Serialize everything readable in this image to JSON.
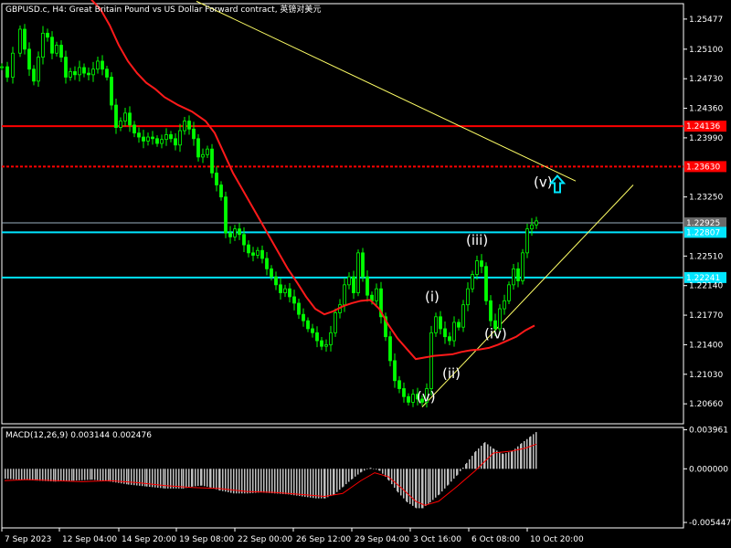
{
  "window_title": "GBPUSD.c, H4:  Great Britain Pound vs US Dollar Forward contract, 英镑对美元",
  "colors": {
    "background": "#000000",
    "candle": "#00ff00",
    "ma": "#ff1a1a",
    "resistance": "#ff0000",
    "support": "#00e5ff",
    "trendline": "#ffff66",
    "macd_hist": "#c0c0c0",
    "macd_signal": "#ff0000",
    "arrow": "#00e5ff",
    "axis_text": "#ffffff"
  },
  "chart_data": [
    {
      "type": "candlestick",
      "title": "GBPUSD.c, H4:  Great Britain Pound vs US Dollar Forward contract, 英镑对美元",
      "ylim": [
        1.2041,
        1.2567
      ],
      "y_ticks": [
        "1.25477",
        "1.25100",
        "1.24730",
        "1.24360",
        "1.23990",
        "1.23250",
        "1.22510",
        "1.22140",
        "1.21770",
        "1.21400",
        "1.21030",
        "1.20660"
      ],
      "x_ticks": [
        "7 Sep 2023",
        "12 Sep 04:00",
        "14 Sep 20:00",
        "19 Sep 08:00",
        "22 Sep 00:00",
        "26 Sep 12:00",
        "29 Sep 04:00",
        "3 Oct 16:00",
        "6 Oct 08:00",
        "10 Oct 20:00"
      ],
      "close_path": [
        [
          0,
          1.2488
        ],
        [
          6,
          1.2475
        ],
        [
          12,
          1.2505
        ],
        [
          20,
          1.2535
        ],
        [
          25,
          1.251
        ],
        [
          30,
          1.2485
        ],
        [
          35,
          1.247
        ],
        [
          40,
          1.25
        ],
        [
          45,
          1.253
        ],
        [
          50,
          1.2525
        ],
        [
          55,
          1.2505
        ],
        [
          60,
          1.2515
        ],
        [
          65,
          1.25
        ],
        [
          70,
          1.2475
        ],
        [
          75,
          1.2482
        ],
        [
          80,
          1.2478
        ],
        [
          85,
          1.2487
        ],
        [
          90,
          1.248
        ],
        [
          95,
          1.2478
        ],
        [
          100,
          1.2485
        ],
        [
          105,
          1.2495
        ],
        [
          110,
          1.2485
        ],
        [
          115,
          1.2475
        ],
        [
          120,
          1.244
        ],
        [
          125,
          1.2412
        ],
        [
          130,
          1.242
        ],
        [
          135,
          1.243
        ],
        [
          140,
          1.2415
        ],
        [
          145,
          1.2405
        ],
        [
          150,
          1.24
        ],
        [
          155,
          1.2395
        ],
        [
          160,
          1.24
        ],
        [
          165,
          1.2398
        ],
        [
          170,
          1.2392
        ],
        [
          175,
          1.2397
        ],
        [
          180,
          1.2403
        ],
        [
          185,
          1.2398
        ],
        [
          190,
          1.239
        ],
        [
          195,
          1.2408
        ],
        [
          200,
          1.242
        ],
        [
          205,
          1.241
        ],
        [
          210,
          1.2398
        ],
        [
          215,
          1.2375
        ],
        [
          220,
          1.2378
        ],
        [
          225,
          1.2385
        ],
        [
          230,
          1.2355
        ],
        [
          235,
          1.234
        ],
        [
          240,
          1.2325
        ],
        [
          245,
          1.228
        ],
        [
          250,
          1.2275
        ],
        [
          255,
          1.2285
        ],
        [
          260,
          1.2278
        ],
        [
          265,
          1.2265
        ],
        [
          270,
          1.2255
        ],
        [
          275,
          1.2252
        ],
        [
          280,
          1.2258
        ],
        [
          285,
          1.2248
        ],
        [
          290,
          1.2235
        ],
        [
          295,
          1.2225
        ],
        [
          300,
          1.2215
        ],
        [
          305,
          1.2205
        ],
        [
          310,
          1.221
        ],
        [
          315,
          1.22
        ],
        [
          320,
          1.2192
        ],
        [
          325,
          1.2178
        ],
        [
          330,
          1.217
        ],
        [
          335,
          1.216
        ],
        [
          340,
          1.2155
        ],
        [
          345,
          1.2145
        ],
        [
          350,
          1.2138
        ],
        [
          355,
          1.214
        ],
        [
          360,
          1.2155
        ],
        [
          365,
          1.218
        ],
        [
          370,
          1.219
        ],
        [
          375,
          1.2215
        ],
        [
          380,
          1.2225
        ],
        [
          385,
          1.2205
        ],
        [
          390,
          1.2255
        ],
        [
          395,
          1.2225
        ],
        [
          400,
          1.2202
        ],
        [
          405,
          1.2195
        ],
        [
          410,
          1.221
        ],
        [
          415,
          1.2175
        ],
        [
          420,
          1.215
        ],
        [
          425,
          1.212
        ],
        [
          430,
          1.2095
        ],
        [
          435,
          1.2085
        ],
        [
          440,
          1.2075
        ],
        [
          445,
          1.2068
        ],
        [
          450,
          1.2078
        ],
        [
          455,
          1.2072
        ],
        [
          460,
          1.2068
        ],
        [
          465,
          1.2085
        ],
        [
          470,
          1.2155
        ],
        [
          475,
          1.2175
        ],
        [
          480,
          1.216
        ],
        [
          485,
          1.215
        ],
        [
          490,
          1.2145
        ],
        [
          495,
          1.2168
        ],
        [
          500,
          1.2162
        ],
        [
          505,
          1.219
        ],
        [
          510,
          1.221
        ],
        [
          515,
          1.2228
        ],
        [
          520,
          1.2245
        ],
        [
          525,
          1.2238
        ],
        [
          530,
          1.2195
        ],
        [
          535,
          1.217
        ],
        [
          540,
          1.216
        ],
        [
          545,
          1.2185
        ],
        [
          550,
          1.2195
        ],
        [
          555,
          1.2215
        ],
        [
          560,
          1.2235
        ],
        [
          565,
          1.222
        ],
        [
          570,
          1.2255
        ],
        [
          575,
          1.2285
        ],
        [
          580,
          1.229
        ],
        [
          585,
          1.2295
        ]
      ],
      "moving_average": [
        [
          100,
          1.2572
        ],
        [
          110,
          1.256
        ],
        [
          120,
          1.254
        ],
        [
          130,
          1.2515
        ],
        [
          140,
          1.2495
        ],
        [
          150,
          1.248
        ],
        [
          160,
          1.2468
        ],
        [
          170,
          1.246
        ],
        [
          180,
          1.245
        ],
        [
          195,
          1.244
        ],
        [
          210,
          1.2432
        ],
        [
          225,
          1.242
        ],
        [
          235,
          1.2405
        ],
        [
          245,
          1.238
        ],
        [
          255,
          1.2355
        ],
        [
          265,
          1.2335
        ],
        [
          275,
          1.2315
        ],
        [
          285,
          1.2295
        ],
        [
          295,
          1.2275
        ],
        [
          305,
          1.2255
        ],
        [
          315,
          1.2235
        ],
        [
          325,
          1.2218
        ],
        [
          335,
          1.22
        ],
        [
          345,
          1.2185
        ],
        [
          355,
          1.2178
        ],
        [
          365,
          1.2182
        ],
        [
          375,
          1.2188
        ],
        [
          385,
          1.2192
        ],
        [
          395,
          1.2195
        ],
        [
          405,
          1.2196
        ],
        [
          415,
          1.2185
        ],
        [
          425,
          1.2165
        ],
        [
          435,
          1.2148
        ],
        [
          445,
          1.2135
        ],
        [
          455,
          1.2122
        ],
        [
          465,
          1.2124
        ],
        [
          475,
          1.2126
        ],
        [
          485,
          1.2127
        ],
        [
          495,
          1.2128
        ],
        [
          505,
          1.2131
        ],
        [
          515,
          1.2133
        ],
        [
          525,
          1.2134
        ],
        [
          535,
          1.2136
        ],
        [
          545,
          1.214
        ],
        [
          555,
          1.2145
        ],
        [
          565,
          1.215
        ],
        [
          575,
          1.2158
        ],
        [
          585,
          1.2164
        ]
      ],
      "horizontal_levels": [
        {
          "price": 1.24136,
          "label": "1.24136",
          "kind": "resistance"
        },
        {
          "price": 1.2363,
          "label": "1.23630",
          "kind": "resistance"
        },
        {
          "price": 1.22925,
          "label": "1.22925",
          "kind": "current"
        },
        {
          "price": 1.22807,
          "label": "1.22807",
          "kind": "support"
        },
        {
          "price": 1.22241,
          "label": "1.22241",
          "kind": "support"
        }
      ],
      "trendlines": [
        {
          "from": [
            215,
            1.257
          ],
          "to": [
            630,
            1.2345
          ]
        },
        {
          "from": [
            462,
            1.2062
          ],
          "to": [
            693,
            1.234
          ]
        }
      ],
      "wave_labels": [
        {
          "text": "(i)",
          "x": 465,
          "price": 1.2194
        },
        {
          "text": "(ii)",
          "x": 484,
          "price": 1.2098
        },
        {
          "text": "(iii)",
          "x": 510,
          "price": 1.2265
        },
        {
          "text": "(iv)",
          "x": 530,
          "price": 1.2148
        },
        {
          "text": "(v)",
          "x": 456,
          "price": 1.2069
        },
        {
          "text": "(v)",
          "x": 584,
          "price": 1.2338
        }
      ],
      "arrow": {
        "x": 610,
        "price": 1.234
      }
    },
    {
      "type": "bar",
      "title": "MACD(12,26,9) 0.003144 0.002476",
      "ylim": [
        -0.006,
        0.0042
      ],
      "y_ticks": [
        "0.003961",
        "0.000000",
        "-0.005447"
      ],
      "histogram": [
        [
          5,
          -0.001
        ],
        [
          20,
          -0.0011
        ],
        [
          40,
          -0.0012
        ],
        [
          60,
          -0.0013
        ],
        [
          80,
          -0.0012
        ],
        [
          100,
          -0.0011
        ],
        [
          120,
          -0.0013
        ],
        [
          140,
          -0.0016
        ],
        [
          160,
          -0.0018
        ],
        [
          180,
          -0.002
        ],
        [
          200,
          -0.002
        ],
        [
          210,
          -0.0018
        ],
        [
          220,
          -0.0017
        ],
        [
          230,
          -0.0019
        ],
        [
          240,
          -0.0022
        ],
        [
          255,
          -0.0025
        ],
        [
          270,
          -0.0025
        ],
        [
          285,
          -0.0024
        ],
        [
          300,
          -0.0025
        ],
        [
          315,
          -0.0026
        ],
        [
          330,
          -0.0028
        ],
        [
          345,
          -0.003
        ],
        [
          355,
          -0.003
        ],
        [
          365,
          -0.0026
        ],
        [
          375,
          -0.0018
        ],
        [
          385,
          -0.001
        ],
        [
          395,
          -0.0003
        ],
        [
          405,
          0.0001
        ],
        [
          415,
          -0.0002
        ],
        [
          425,
          -0.0012
        ],
        [
          435,
          -0.0024
        ],
        [
          445,
          -0.0034
        ],
        [
          455,
          -0.004
        ],
        [
          462,
          -0.004
        ],
        [
          470,
          -0.0034
        ],
        [
          480,
          -0.0026
        ],
        [
          490,
          -0.0016
        ],
        [
          500,
          -0.0006
        ],
        [
          510,
          0.0006
        ],
        [
          520,
          0.0018
        ],
        [
          530,
          0.0027
        ],
        [
          540,
          0.002
        ],
        [
          550,
          0.0015
        ],
        [
          560,
          0.0018
        ],
        [
          570,
          0.0026
        ],
        [
          580,
          0.0033
        ],
        [
          587,
          0.0038
        ]
      ],
      "signal": [
        [
          5,
          -0.0012
        ],
        [
          30,
          -0.0011
        ],
        [
          60,
          -0.0012
        ],
        [
          90,
          -0.0013
        ],
        [
          120,
          -0.0012
        ],
        [
          150,
          -0.0014
        ],
        [
          180,
          -0.0017
        ],
        [
          210,
          -0.0019
        ],
        [
          240,
          -0.002
        ],
        [
          270,
          -0.0023
        ],
        [
          300,
          -0.0024
        ],
        [
          330,
          -0.0026
        ],
        [
          355,
          -0.0028
        ],
        [
          375,
          -0.0025
        ],
        [
          395,
          -0.0012
        ],
        [
          410,
          -0.0004
        ],
        [
          425,
          -0.0008
        ],
        [
          440,
          -0.002
        ],
        [
          455,
          -0.0033
        ],
        [
          465,
          -0.0037
        ],
        [
          480,
          -0.0033
        ],
        [
          500,
          -0.0018
        ],
        [
          520,
          -0.0002
        ],
        [
          540,
          0.0016
        ],
        [
          560,
          0.0018
        ],
        [
          575,
          0.0021
        ],
        [
          587,
          0.0025
        ]
      ]
    }
  ]
}
